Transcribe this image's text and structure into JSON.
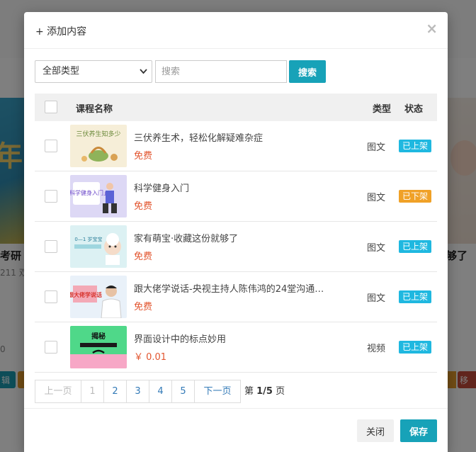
{
  "background": {
    "left_title": "考研",
    "left_sub": "211 双",
    "left_count": "0",
    "left_button": "辑",
    "right_title": "够了",
    "right_button": "移",
    "left_card_text": "年"
  },
  "modal": {
    "title": "+ 添加内容",
    "close_glyph": "×"
  },
  "filters": {
    "type_value": "全部类型",
    "search_placeholder": "搜索",
    "search_button": "搜索"
  },
  "table": {
    "headers": {
      "name": "课程名称",
      "type": "类型",
      "status": "状态"
    },
    "rows": [
      {
        "title": "三伏养生术，轻松化解疑难杂症",
        "price": "免费",
        "type": "图文",
        "status": "已上架",
        "status_color": "#1fb8e0",
        "thumb_text": "三伏养生知多少",
        "thumb_bg": "#f6eed8"
      },
      {
        "title": "科学健身入门",
        "price": "免费",
        "type": "图文",
        "status": "已下架",
        "status_color": "#f0a127",
        "thumb_text": "「科学健身入门」",
        "thumb_bg": "#ddd8f5"
      },
      {
        "title": "家有萌宝·收藏这份就够了",
        "price": "免费",
        "type": "图文",
        "status": "已上架",
        "status_color": "#1fb8e0",
        "thumb_text": "0—1 岁宝宝",
        "thumb_bg": "#dcf1f3"
      },
      {
        "title": "跟大佬学说话-央视主持人陈伟鸿的24堂沟通…",
        "price": "免费",
        "type": "图文",
        "status": "已上架",
        "status_color": "#1fb8e0",
        "thumb_text": "跟大佬学说话",
        "thumb_bg": "#e9f1f9"
      },
      {
        "title": "界面设计中的标点妙用",
        "price": "￥ 0.01",
        "type": "视频",
        "status": "已上架",
        "status_color": "#1fb8e0",
        "thumb_text": "揭秘",
        "thumb_bg": "#4fd889"
      }
    ]
  },
  "pagination": {
    "prev": "上一页",
    "pages": [
      "1",
      "2",
      "3",
      "4",
      "5"
    ],
    "next": "下一页",
    "info_prefix": "第 ",
    "info_current": "1/5",
    "info_suffix": " 页"
  },
  "footer": {
    "close_label": "关闭",
    "save_label": "保存"
  },
  "colors": {
    "primary": "#17a2b8",
    "price": "#e2552f",
    "online_badge": "#1fb8e0",
    "offline_badge": "#f0a127"
  }
}
